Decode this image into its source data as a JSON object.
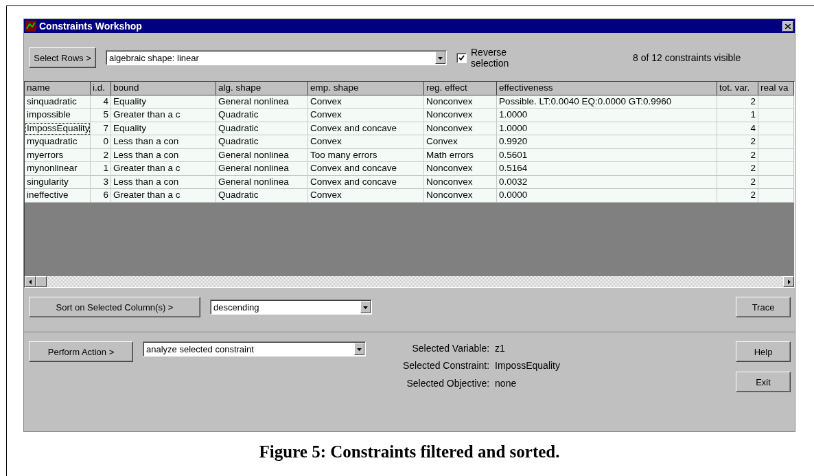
{
  "window": {
    "title": "Constraints Workshop"
  },
  "select_rows": {
    "button": "Select Rows >",
    "dropdown": "algebraic shape: linear",
    "reverse_selection": {
      "label": "Reverse selection",
      "checked": true
    },
    "visible_count": "8 of 12 constraints visible"
  },
  "table": {
    "columns": [
      "name",
      "i.d.",
      "bound",
      "alg. shape",
      "emp. shape",
      "reg. effect",
      "effectiveness",
      "tot. var.",
      "real va"
    ],
    "rows": [
      {
        "focused": false,
        "cells": [
          "sinquadratic",
          "4",
          "Equality",
          "General nonlinea",
          "Convex",
          "Nonconvex",
          "Possible. LT:0.0040  EQ:0.0000  GT:0.9960",
          "2"
        ]
      },
      {
        "focused": false,
        "cells": [
          "impossible",
          "5",
          "Greater than a c",
          "Quadratic",
          "Convex",
          "Nonconvex",
          "1.0000",
          "1"
        ]
      },
      {
        "focused": true,
        "cells": [
          "ImpossEquality",
          "7",
          "Equality",
          "Quadratic",
          "Convex and concave",
          "Nonconvex",
          "1.0000",
          "4"
        ]
      },
      {
        "focused": false,
        "cells": [
          "myquadratic",
          "0",
          "Less than a con",
          "Quadratic",
          "Convex",
          "Convex",
          "0.9920",
          "2"
        ]
      },
      {
        "focused": false,
        "cells": [
          "myerrors",
          "2",
          "Less than a con",
          "General nonlinea",
          "Too many errors",
          "Math errors",
          "0.5601",
          "2"
        ]
      },
      {
        "focused": false,
        "cells": [
          "mynonlinear",
          "1",
          "Greater than a c",
          "General nonlinea",
          "Convex and concave",
          "Nonconvex",
          "0.5164",
          "2"
        ]
      },
      {
        "focused": false,
        "cells": [
          "singularity",
          "3",
          "Less than a con",
          "General nonlinea",
          "Convex and concave",
          "Nonconvex",
          "0.0032",
          "2"
        ]
      },
      {
        "focused": false,
        "cells": [
          "ineffective",
          "6",
          "Greater than a c",
          "Quadratic",
          "Convex",
          "Nonconvex",
          "0.0000",
          "2"
        ]
      }
    ]
  },
  "sort": {
    "button": "Sort on Selected Column(s) >",
    "dropdown": "descending"
  },
  "trace_button": "Trace",
  "action": {
    "button": "Perform Action >",
    "dropdown": "analyze selected constraint"
  },
  "selection_info": [
    {
      "label": "Selected Variable:",
      "value": "z1"
    },
    {
      "label": "Selected Constraint:",
      "value": "ImpossEquality"
    },
    {
      "label": "Selected Objective:",
      "value": "none"
    }
  ],
  "buttons": [
    "Help",
    "Exit"
  ],
  "caption": "Figure 5: Constraints filtered and sorted."
}
